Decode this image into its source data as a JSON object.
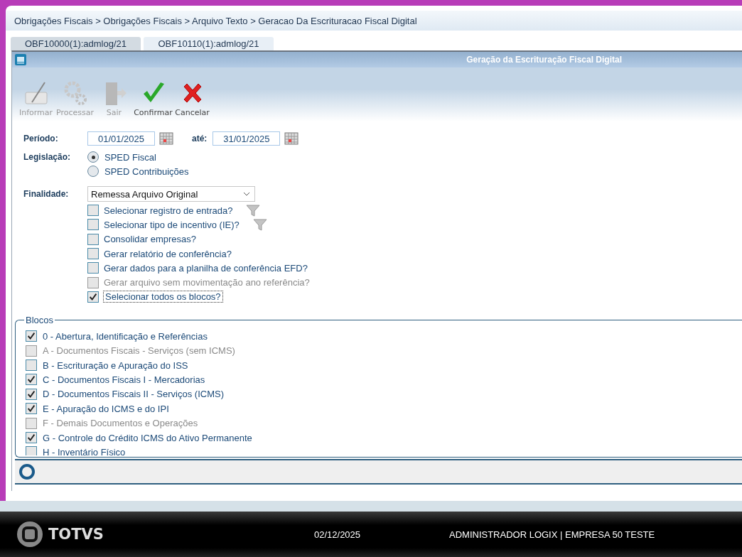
{
  "breadcrumb": "Obrigações Fiscais > Obrigações Fiscais > Arquivo Texto > Geracao Da Escrituracao Fiscal Digital",
  "tabs": [
    {
      "label": "OBF10000(1):admlog/21",
      "selected": false
    },
    {
      "label": "OBF10110(1):admlog/21",
      "selected": true
    }
  ],
  "window": {
    "title": "Geração da Escrituração Fiscal Digital"
  },
  "toolbar": [
    {
      "kind": "edit",
      "label": "Informar",
      "disabled": true
    },
    {
      "kind": "process",
      "label": "Processar",
      "disabled": true
    },
    {
      "kind": "exit",
      "label": "Sair",
      "disabled": true
    },
    {
      "kind": "confirm",
      "label": "Confirmar",
      "disabled": false
    },
    {
      "kind": "cancel",
      "label": "Cancelar",
      "disabled": false
    }
  ],
  "periodo": {
    "label": "Período:",
    "from": "01/01/2025",
    "to_label": "até:",
    "to": "31/01/2025"
  },
  "legislacao": {
    "label": "Legislação:",
    "options": [
      {
        "label": "SPED Fiscal",
        "selected": true
      },
      {
        "label": "SPED Contribuições",
        "selected": false
      }
    ]
  },
  "finalidade": {
    "label": "Finalidade:",
    "value": "Remessa Arquivo Original"
  },
  "options": [
    {
      "label": "Selecionar registro de entrada?",
      "checked": false,
      "disabled": false,
      "filter": true,
      "focused": false
    },
    {
      "label": "Selecionar tipo de incentivo (IE)?",
      "checked": false,
      "disabled": false,
      "filter": true,
      "focused": false
    },
    {
      "label": "Consolidar empresas?",
      "checked": false,
      "disabled": false,
      "filter": false,
      "focused": false
    },
    {
      "label": "Gerar relatório de conferência?",
      "checked": false,
      "disabled": false,
      "filter": false,
      "focused": false
    },
    {
      "label": "Gerar dados para a planilha de conferência EFD?",
      "checked": false,
      "disabled": false,
      "filter": false,
      "focused": false
    },
    {
      "label": "Gerar arquivo sem movimentação ano referência?",
      "checked": false,
      "disabled": true,
      "filter": false,
      "focused": false
    },
    {
      "label": "Selecionar todos os blocos?",
      "checked": true,
      "disabled": false,
      "filter": false,
      "focused": true
    }
  ],
  "blocos": {
    "legend": "Blocos",
    "items": [
      {
        "label": "0 - Abertura, Identificação  e Referências",
        "checked": true,
        "disabled": false
      },
      {
        "label": "A - Documentos Fiscais -  Serviços (sem ICMS)",
        "checked": false,
        "disabled": true
      },
      {
        "label": "B - Escrituração e Apuração do ISS",
        "checked": false,
        "disabled": false
      },
      {
        "label": "C - Documentos Fiscais I - Mercadorias",
        "checked": true,
        "disabled": false
      },
      {
        "label": "D - Documentos Fiscais II - Serviços (ICMS)",
        "checked": true,
        "disabled": false
      },
      {
        "label": "E - Apuração do ICMS e do IPI",
        "checked": true,
        "disabled": false
      },
      {
        "label": "F - Demais Documentos e Operações",
        "checked": false,
        "disabled": true
      },
      {
        "label": "G - Controle do Crédito ICMS do Ativo Permanente",
        "checked": true,
        "disabled": false
      },
      {
        "label": "H - Inventário Físico",
        "checked": false,
        "disabled": false
      }
    ]
  },
  "footer": {
    "brand": "TOTVS",
    "date": "02/12/2025",
    "user": "ADMINISTRADOR LOGIX | EMPRESA 50 TESTE"
  }
}
